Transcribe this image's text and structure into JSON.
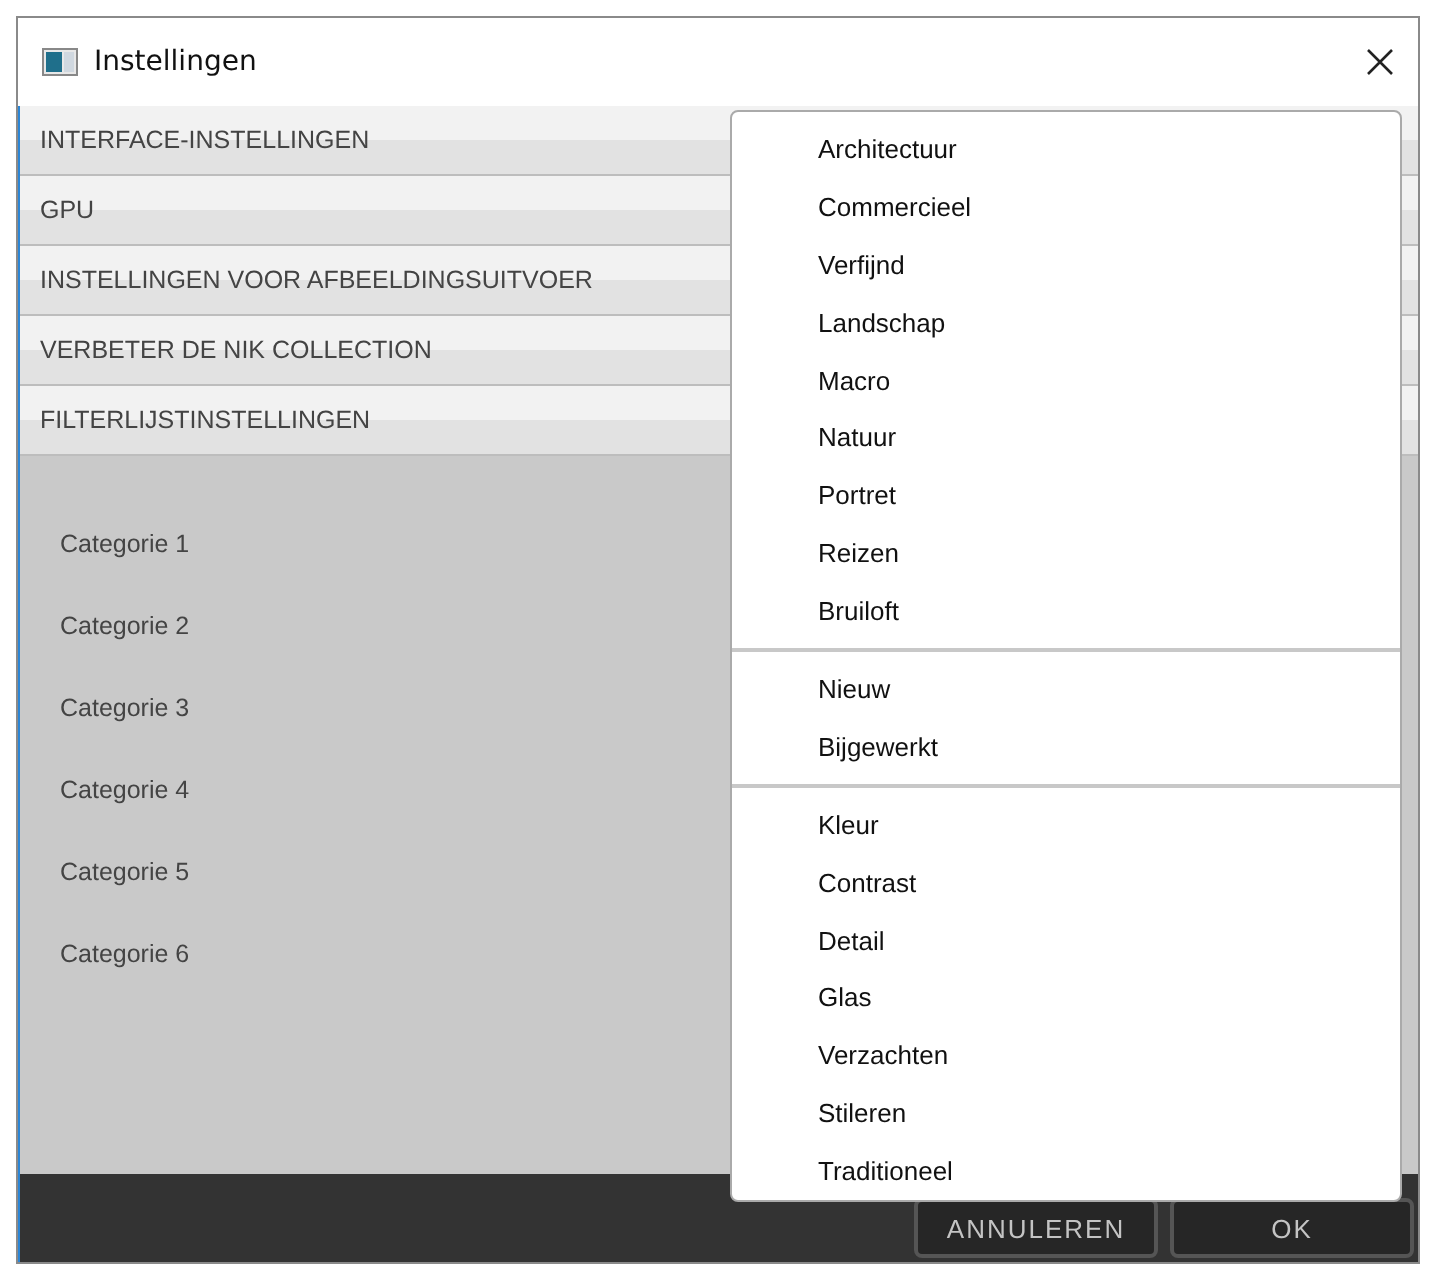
{
  "window": {
    "title": "Instellingen"
  },
  "sections": [
    "INTERFACE-INSTELLINGEN",
    "GPU",
    "INSTELLINGEN VOOR AFBEELDINGSUITVOER",
    "VERBETER DE NIK COLLECTION",
    "FILTERLIJSTINSTELLINGEN"
  ],
  "categories": [
    "Categorie 1",
    "Categorie 2",
    "Categorie 3",
    "Categorie 4",
    "Categorie 5",
    "Categorie 6"
  ],
  "buttons": [
    "ANNULEREN",
    "OK"
  ],
  "menu": {
    "groups": [
      {
        "items": [
          "Architectuur",
          "Commercieel",
          "Verfijnd",
          "Landschap",
          "Macro",
          "Natuur",
          "Portret",
          "Reizen",
          "Bruiloft"
        ]
      },
      {
        "items": [
          "Nieuw",
          "Bijgewerkt"
        ]
      },
      {
        "items": [
          "Kleur",
          "Contrast",
          "Detail",
          "Glas",
          "Verzachten",
          "Stileren",
          "Traditioneel"
        ]
      }
    ]
  }
}
